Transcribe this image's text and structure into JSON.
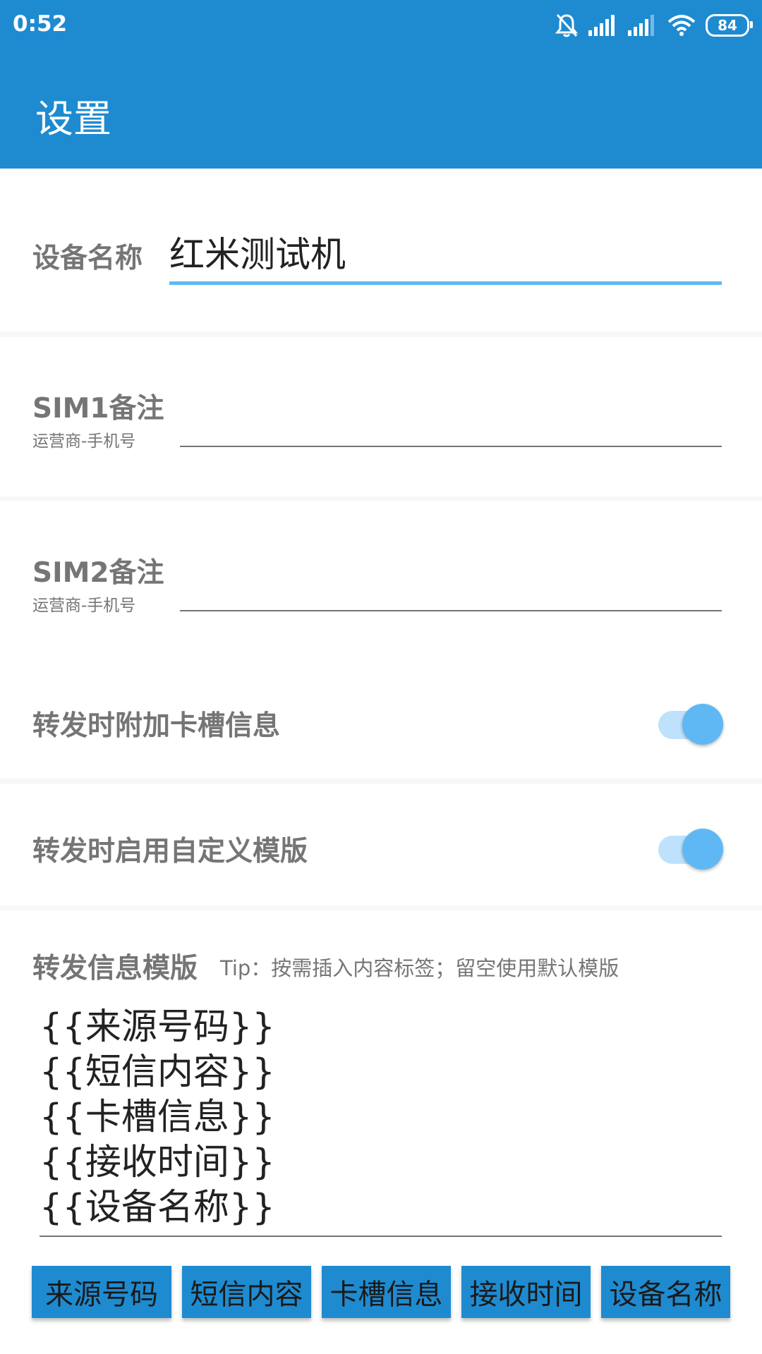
{
  "status_bar": {
    "time": "0:52",
    "battery": "84",
    "icons": [
      "bell-mute-icon",
      "signal-icon",
      "signal-icon",
      "wifi-icon",
      "battery-icon"
    ]
  },
  "app_bar": {
    "title": "设置"
  },
  "device_name": {
    "label": "设备名称",
    "value": "红米测试机",
    "accent": "#5fb8f4"
  },
  "sim1": {
    "label": "SIM1备注",
    "hint": "运营商-手机号",
    "value": ""
  },
  "sim2": {
    "label": "SIM2备注",
    "hint": "运营商-手机号",
    "value": ""
  },
  "toggles": [
    {
      "label": "转发时附加卡槽信息",
      "on": true
    },
    {
      "label": "转发时启用自定义模版",
      "on": true
    }
  ],
  "template": {
    "label": "转发信息模版",
    "tip": "Tip：按需插入内容标签；留空使用默认模版",
    "text": "{{来源号码}}\n{{短信内容}}\n{{卡槽信息}}\n{{接收时间}}\n{{设备名称}}"
  },
  "tag_buttons": [
    "来源号码",
    "短信内容",
    "卡槽信息",
    "接收时间",
    "设备名称"
  ],
  "colors": {
    "primary": "#1e8bd1",
    "switch_thumb": "#5fb8f4",
    "switch_track": "#bee2fb",
    "label_gray": "#757575"
  }
}
